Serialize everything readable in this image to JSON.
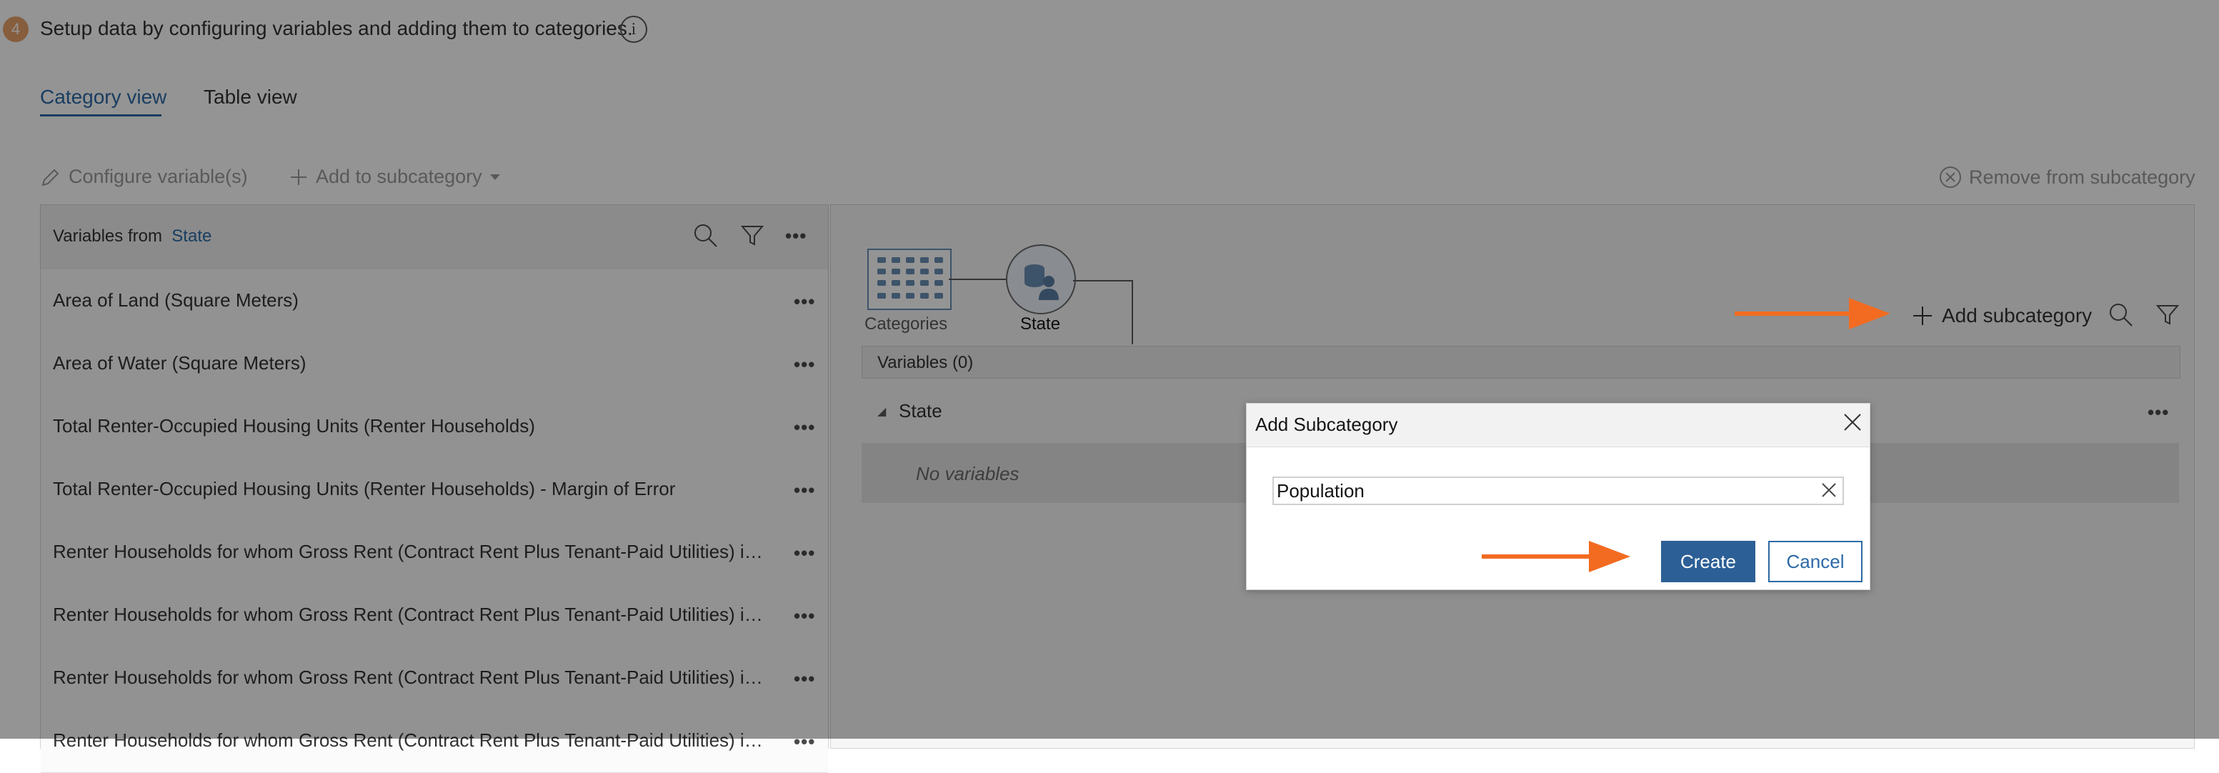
{
  "step": {
    "number": "4",
    "text": "Setup data by configuring variables and adding them to categories.",
    "info_icon": "info-icon"
  },
  "tabs": [
    {
      "label": "Category view",
      "active": true
    },
    {
      "label": "Table view",
      "active": false
    }
  ],
  "toolbar": {
    "configure_label": "Configure variable(s)",
    "add_to_sub_label": "Add to subcategory",
    "remove_label": "Remove from subcategory"
  },
  "left_panel": {
    "header_prefix": "Variables from",
    "header_link": "State",
    "rows": [
      "Area of Land (Square Meters)",
      "Area of Water (Square Meters)",
      "Total Renter-Occupied Housing Units (Renter Households)",
      "Total Renter-Occupied Housing Units (Renter Households) - Margin of Error",
      "Renter Households for whom Gross Rent (Contract Rent Plus Tenant-Paid Utilities) is…",
      "Renter Households for whom Gross Rent (Contract Rent Plus Tenant-Paid Utilities) is…",
      "Renter Households for whom Gross Rent (Contract Rent Plus Tenant-Paid Utilities) is…",
      "Renter Households for whom Gross Rent (Contract Rent Plus Tenant-Paid Utilities) is…"
    ],
    "more_glyph": "•••"
  },
  "right_panel": {
    "graph_categories_label": "Categories",
    "graph_state_label": "State",
    "add_subcategory_label": "Add subcategory",
    "variables_header": "Variables (0)",
    "state_label": "State",
    "no_variables": "No variables",
    "more_glyph": "•••"
  },
  "dialog": {
    "title": "Add Subcategory",
    "input_value": "Population",
    "create_label": "Create",
    "cancel_label": "Cancel"
  },
  "colors": {
    "accent_blue": "#2c6aa6",
    "button_blue": "#2c5f95",
    "annotation_orange": "#f26b21",
    "step_badge": "#e7a36a"
  }
}
